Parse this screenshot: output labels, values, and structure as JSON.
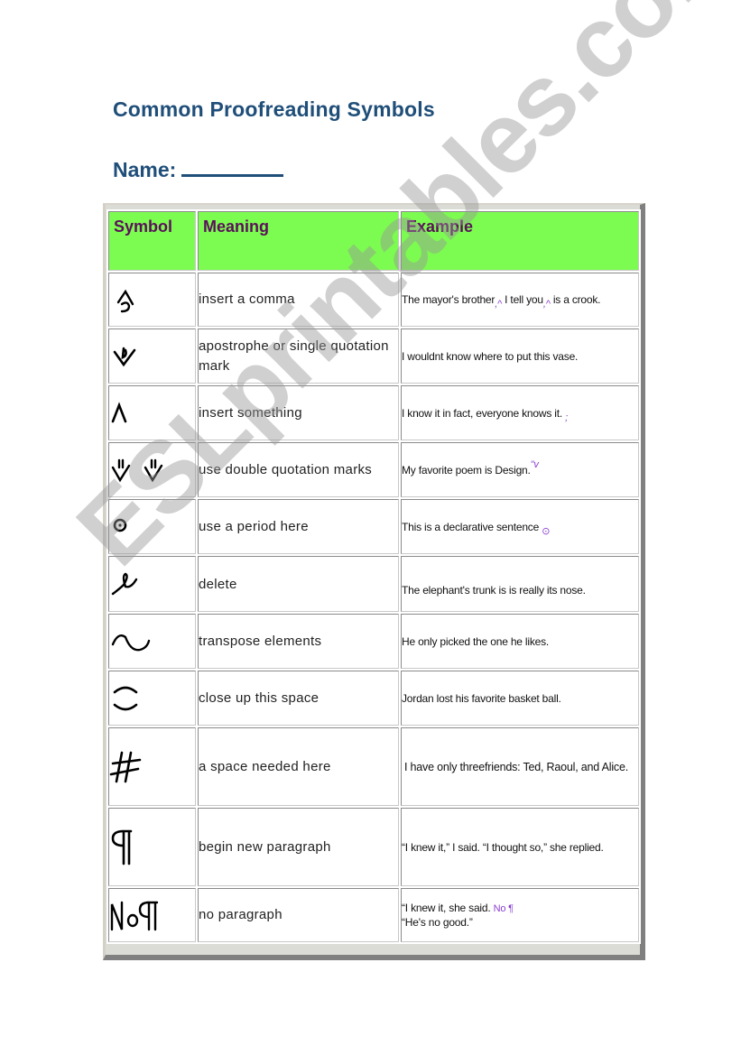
{
  "document": {
    "title": "Common Proofreading Symbols",
    "name_label": "Name:",
    "name_value": ""
  },
  "table": {
    "headers": [
      "Symbol",
      "Meaning",
      "Example"
    ],
    "header_color": "#7cfc50",
    "header_text_color": "#5b0f5b",
    "rows": [
      {
        "symbol": "comma-insert-icon",
        "meaning": "insert a comma",
        "example": "The mayor's brother, I tell you, is a crook.",
        "ex_a": "The mayor's brother",
        "ex_b": " I tell you",
        "ex_c": " is a crook."
      },
      {
        "symbol": "apostrophe-icon",
        "meaning": "apostrophe or single quotation mark",
        "example": "I wouldnt know where to put this vase.",
        "ex_a": "I wouldnt know where to put this vase."
      },
      {
        "symbol": "caret-insert-icon",
        "meaning": "insert something",
        "example": "I know it in fact, everyone knows it.",
        "ex_a": "I know it in fact, everyone knows it."
      },
      {
        "symbol": "double-quote-icon",
        "meaning": "use double quotation marks",
        "example": "My favorite poem is Design.",
        "ex_a": "My favorite poem is Design."
      },
      {
        "symbol": "period-circle-icon",
        "meaning": "use a period here",
        "example": "This is a declarative sentence",
        "ex_a": "This is a declarative sentence"
      },
      {
        "symbol": "delete-icon",
        "meaning": "delete",
        "example": "The elephant's trunk is is really its nose.",
        "ex_a": "The elephant's trunk is is really its nose."
      },
      {
        "symbol": "transpose-icon",
        "meaning": "transpose elements",
        "example": "He only picked the one he likes.",
        "ex_a": "He only picked the one he likes."
      },
      {
        "symbol": "close-space-icon",
        "meaning": "close up this space",
        "example": "Jordan lost his favorite basket ball.",
        "ex_a": "Jordan lost his favorite basket ball."
      },
      {
        "symbol": "space-hash-icon",
        "meaning": "a space needed here",
        "example": "I have only threefriends: Ted, Raoul, and Alice.",
        "ex_a": "I have only threefriends: Ted, Raoul, and Alice."
      },
      {
        "symbol": "paragraph-icon",
        "meaning": "begin new paragraph",
        "example": "“I knew it,” I said. “I thought so,” she replied.",
        "ex_a": "“I knew it,” I said. “I thought so,” she replied."
      },
      {
        "symbol": "no-paragraph-icon",
        "meaning": "no paragraph",
        "example": "“I knew it, she said. “He's no good.”",
        "ex_a": "“I knew it, she said.",
        "ex_b": "“He's no good.”",
        "mark": "No ¶"
      }
    ]
  },
  "watermark": "ESLprintables.com",
  "mark_color": "#8a3fd1"
}
